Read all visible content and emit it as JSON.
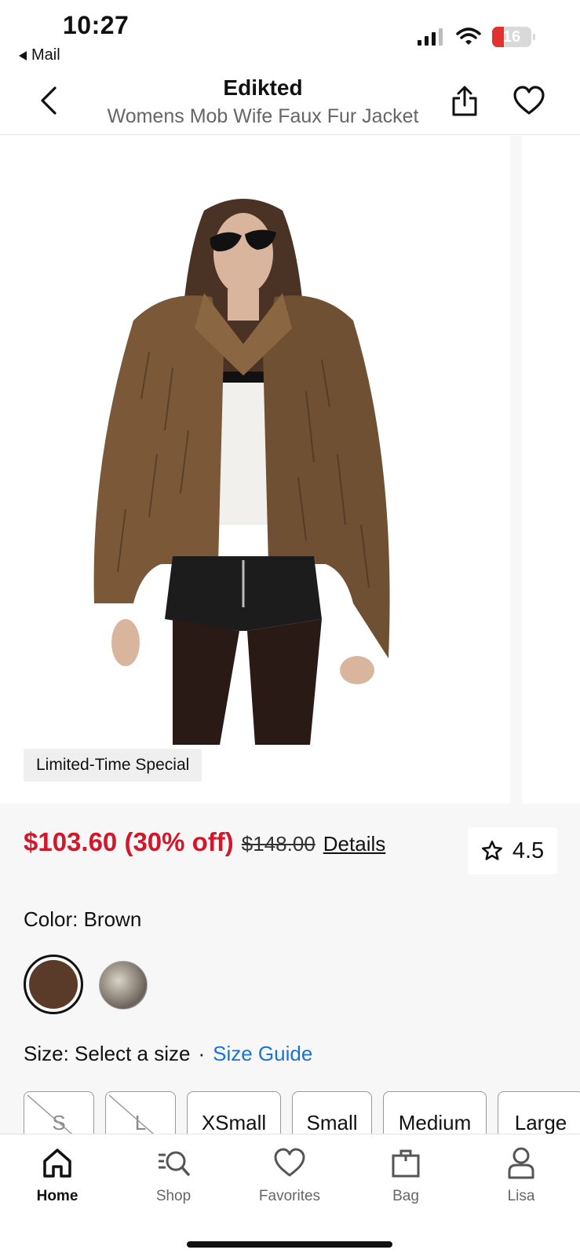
{
  "status_bar": {
    "time": "10:27",
    "back_app": "Mail",
    "battery": "16",
    "icons": [
      "signal-icon",
      "wifi-icon",
      "battery-icon"
    ]
  },
  "header": {
    "brand": "Edikted",
    "product_name": "Womens Mob Wife Faux Fur Jacket",
    "icons": [
      "back-chevron-icon",
      "share-icon",
      "heart-icon"
    ]
  },
  "gallery": {
    "promo_tag": "Limited-Time Special"
  },
  "pricing": {
    "sale_price": "$103.60 (30% off)",
    "original_price": "$148.00",
    "details_link": "Details",
    "rating": "4.5"
  },
  "color": {
    "label": "Color: Brown",
    "swatches": [
      "Brown",
      "Grey"
    ],
    "selected": "Brown"
  },
  "size": {
    "label": "Size: Select a size",
    "separator": "·",
    "guide_link": "Size Guide",
    "options": [
      {
        "label": "S",
        "available": false
      },
      {
        "label": "L",
        "available": false
      },
      {
        "label": "XSmall",
        "available": true
      },
      {
        "label": "Small",
        "available": true
      },
      {
        "label": "Medium",
        "available": true
      },
      {
        "label": "Large",
        "available": true
      }
    ]
  },
  "tab_bar": {
    "tabs": [
      {
        "label": "Home",
        "icon": "home-icon",
        "active": true
      },
      {
        "label": "Shop",
        "icon": "shop-search-icon",
        "active": false
      },
      {
        "label": "Favorites",
        "icon": "heart-icon",
        "active": false
      },
      {
        "label": "Bag",
        "icon": "bag-icon",
        "active": false
      },
      {
        "label": "Lisa",
        "icon": "person-icon",
        "active": false
      }
    ]
  },
  "colors": {
    "sale_red": "#d3172b",
    "link_blue": "#1a73d0",
    "swatch_brown": "#5a3a28"
  }
}
